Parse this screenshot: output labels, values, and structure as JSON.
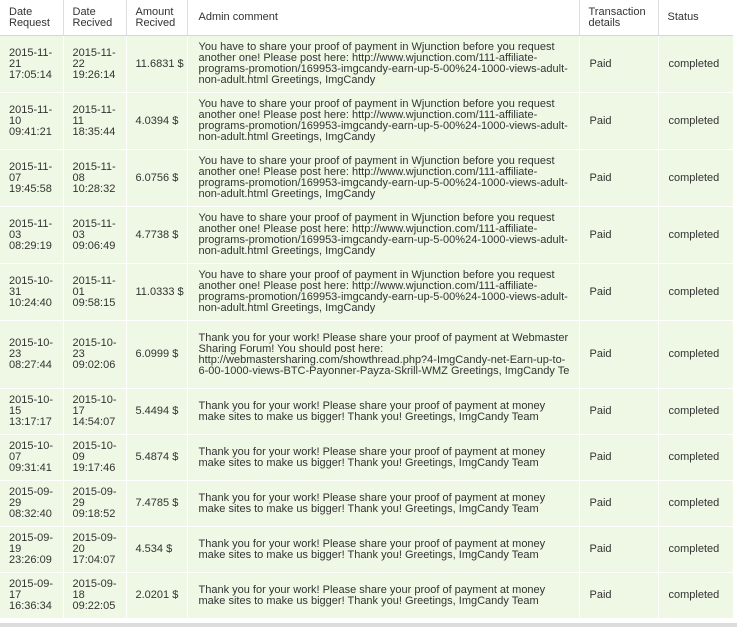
{
  "columns": {
    "date_request": "Date Request",
    "date_received": "Date Recived",
    "amount_received": "Amount Recived",
    "admin_comment": "Admin comment",
    "transaction_details": "Transaction details",
    "status": "Status"
  },
  "rows": [
    {
      "date_request": "2015-11-21 17:05:14",
      "date_received": "2015-11-22 19:26:14",
      "amount": "11.6831 $",
      "comment": "You have to share your proof of payment in Wjunction before you request another one! Please post here: http://www.wjunction.com/111-affiliate-programs-promotion/169953-imgcandy-earn-up-5-00%24-1000-views-adult-non-adult.html Greetings, ImgCandy",
      "details": "Paid",
      "status": "completed"
    },
    {
      "date_request": "2015-11-10 09:41:21",
      "date_received": "2015-11-11 18:35:44",
      "amount": "4.0394 $",
      "comment": "You have to share your proof of payment in Wjunction before you request another one! Please post here: http://www.wjunction.com/111-affiliate-programs-promotion/169953-imgcandy-earn-up-5-00%24-1000-views-adult-non-adult.html Greetings, ImgCandy",
      "details": "Paid",
      "status": "completed"
    },
    {
      "date_request": "2015-11-07 19:45:58",
      "date_received": "2015-11-08 10:28:32",
      "amount": "6.0756 $",
      "comment": "You have to share your proof of payment in Wjunction before you request another one! Please post here: http://www.wjunction.com/111-affiliate-programs-promotion/169953-imgcandy-earn-up-5-00%24-1000-views-adult-non-adult.html Greetings, ImgCandy",
      "details": "Paid",
      "status": "completed"
    },
    {
      "date_request": "2015-11-03 08:29:19",
      "date_received": "2015-11-03 09:06:49",
      "amount": "4.7738 $",
      "comment": "You have to share your proof of payment in Wjunction before you request another one! Please post here: http://www.wjunction.com/111-affiliate-programs-promotion/169953-imgcandy-earn-up-5-00%24-1000-views-adult-non-adult.html Greetings, ImgCandy",
      "details": "Paid",
      "status": "completed"
    },
    {
      "date_request": "2015-10-31 10:24:40",
      "date_received": "2015-11-01 09:58:15",
      "amount": "11.0333 $",
      "comment": "You have to share your proof of payment in Wjunction before you request another one! Please post here: http://www.wjunction.com/111-affiliate-programs-promotion/169953-imgcandy-earn-up-5-00%24-1000-views-adult-non-adult.html Greetings, ImgCandy",
      "details": "Paid",
      "status": "completed"
    },
    {
      "date_request": "2015-10-23 08:27:44",
      "date_received": "2015-10-23 09:02:06",
      "amount": "6.0999 $",
      "comment": "Thank you for your work! Please share your proof of payment at Webmaster Sharing Forum! You should post here: http://webmastersharing.com/showthread.php?4-ImgCandy-net-Earn-up-to-6-00-1000-views-BTC-Payonner-Payza-Skrill-WMZ Greetings, ImgCandy Te",
      "details": "Paid",
      "status": "completed"
    },
    {
      "date_request": "2015-10-15 13:17:17",
      "date_received": "2015-10-17 14:54:07",
      "amount": "5.4494 $",
      "comment": "Thank you for your work! Please share your proof of payment at money make sites to make us bigger! Thank you! Greetings, ImgCandy Team",
      "details": "Paid",
      "status": "completed"
    },
    {
      "date_request": "2015-10-07 09:31:41",
      "date_received": "2015-10-09 19:17:46",
      "amount": "5.4874 $",
      "comment": "Thank you for your work! Please share your proof of payment at money make sites to make us bigger! Thank you! Greetings, ImgCandy Team",
      "details": "Paid",
      "status": "completed"
    },
    {
      "date_request": "2015-09-29 08:32:40",
      "date_received": "2015-09-29 09:18:52",
      "amount": "7.4785 $",
      "comment": "Thank you for your work! Please share your proof of payment at money make sites to make us bigger! Thank you! Greetings, ImgCandy Team",
      "details": "Paid",
      "status": "completed"
    },
    {
      "date_request": "2015-09-19 23:26:09",
      "date_received": "2015-09-20 17:04:07",
      "amount": "4.534 $",
      "comment": "Thank you for your work! Please share your proof of payment at money make sites to make us bigger! Thank you! Greetings, ImgCandy Team",
      "details": "Paid",
      "status": "completed"
    },
    {
      "date_request": "2015-09-17 16:36:34",
      "date_received": "2015-09-18 09:22:05",
      "amount": "2.0201 $",
      "comment": "Thank you for your work! Please share your proof of payment at money make sites to make us bigger! Thank you! Greetings, ImgCandy Team",
      "details": "Paid",
      "status": "completed"
    }
  ],
  "colors": {
    "row_background": "#eef8e5",
    "text": "#333333",
    "bottom_bar": "#dcdcdc"
  }
}
